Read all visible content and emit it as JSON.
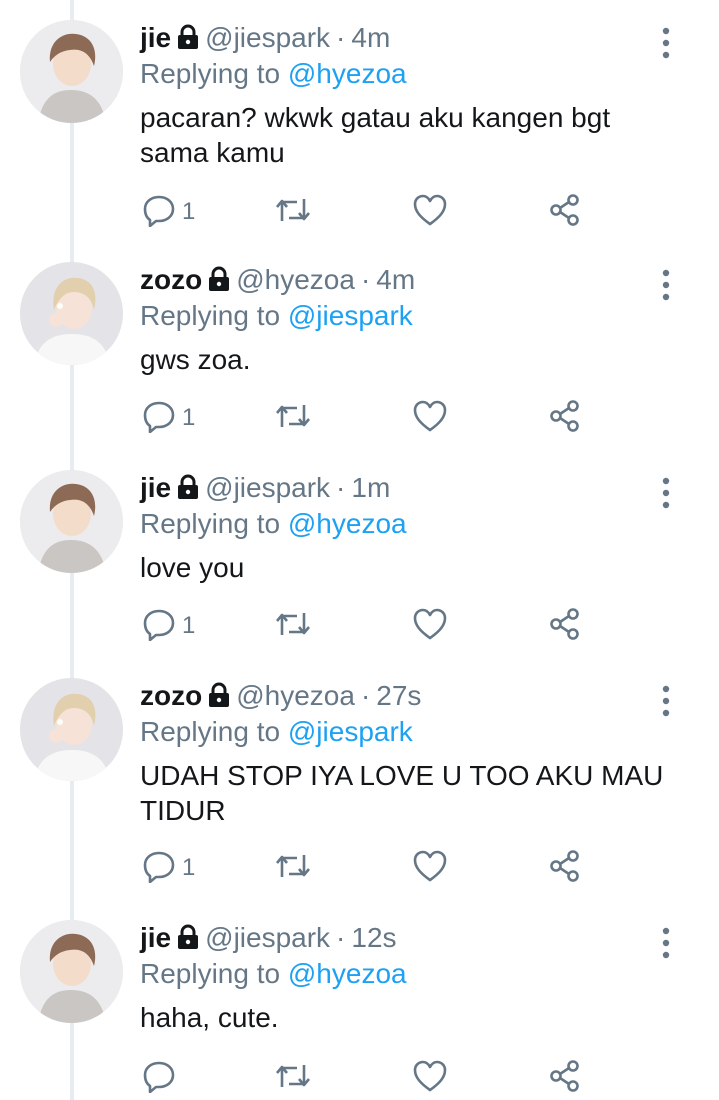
{
  "tweets": [
    {
      "name": "jie",
      "handle": "@jiespark",
      "sep": "·",
      "time": "4m",
      "reply_prefix": "Replying to",
      "reply_to": "@hyezoa",
      "text": "pacaran? wkwk gatau aku kangen bgt sama kamu",
      "reply_count": "1",
      "avatar_icon": "avatar-jie"
    },
    {
      "name": "zozo",
      "handle": "@hyezoa",
      "sep": "·",
      "time": "4m",
      "reply_prefix": "Replying to",
      "reply_to": "@jiespark",
      "text": "gws zoa.",
      "reply_count": "1",
      "avatar_icon": "avatar-zozo"
    },
    {
      "name": "jie",
      "handle": "@jiespark",
      "sep": "·",
      "time": "1m",
      "reply_prefix": "Replying to",
      "reply_to": "@hyezoa",
      "text": "love you",
      "reply_count": "1",
      "avatar_icon": "avatar-jie"
    },
    {
      "name": "zozo",
      "handle": "@hyezoa",
      "sep": "·",
      "time": "27s",
      "reply_prefix": "Replying to",
      "reply_to": "@jiespark",
      "text": "UDAH STOP IYA LOVE U TOO AKU MAU TIDUR",
      "reply_count": "1",
      "avatar_icon": "avatar-zozo"
    },
    {
      "name": "jie",
      "handle": "@jiespark",
      "sep": "·",
      "time": "12s",
      "reply_prefix": "Replying to",
      "reply_to": "@hyezoa",
      "text": "haha, cute.",
      "reply_count": "",
      "avatar_icon": "avatar-jie"
    }
  ],
  "icons": {
    "lock": "lock-icon",
    "more": "more-vertical-icon",
    "reply": "reply-icon",
    "retweet": "retweet-icon",
    "like": "heart-icon",
    "share": "share-icon"
  },
  "colors": {
    "text": "#14171a",
    "secondary": "#657786",
    "link": "#1da1f2",
    "thread_line": "#e6ecf0"
  }
}
